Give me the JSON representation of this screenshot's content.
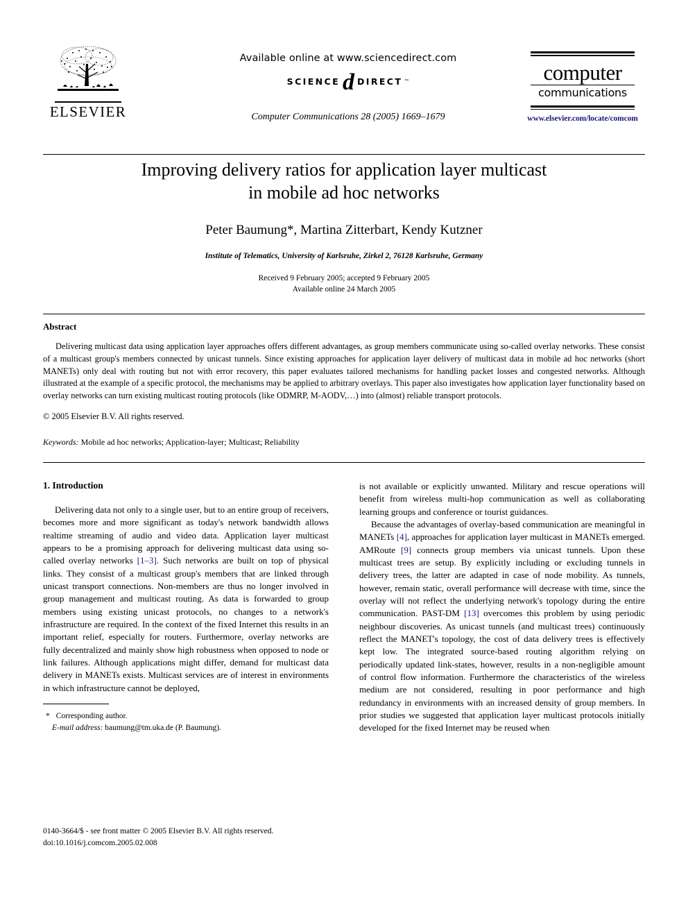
{
  "masthead": {
    "publisher_name": "ELSEVIER",
    "sciencedirect": {
      "available_line": "Available online at www.sciencedirect.com",
      "logo_left": "SCIENCE",
      "logo_at": "d",
      "logo_right": "DIRECT",
      "logo_tm": "™"
    },
    "journal_citation": "Computer Communications 28 (2005) 1669–1679",
    "journal_logo": {
      "line1": "computer",
      "line2": "communications"
    },
    "journal_url": "www.elsevier.com/locate/comcom"
  },
  "title_block": {
    "title_line1": "Improving delivery ratios for application layer multicast",
    "title_line2": "in mobile ad hoc networks",
    "authors": "Peter Baumung*, Martina Zitterbart, Kendy Kutzner",
    "affiliation": "Institute of Telematics, University of Karlsruhe, Zirkel 2, 76128 Karlsruhe, Germany",
    "received_line": "Received 9 February 2005; accepted 9 February 2005",
    "available_line": "Available online 24 March 2005"
  },
  "abstract": {
    "heading": "Abstract",
    "text": "Delivering multicast data using application layer approaches offers different advantages, as group members communicate using so-called overlay networks. These consist of a multicast group's members connected by unicast tunnels. Since existing approaches for application layer delivery of multicast data in mobile ad hoc networks (short MANETs) only deal with routing but not with error recovery, this paper evaluates tailored mechanisms for handling packet losses and congested networks. Although illustrated at the example of a specific protocol, the mechanisms may be applied to arbitrary overlays. This paper also investigates how application layer functionality based on overlay networks can turn existing multicast routing protocols (like ODMRP, M-AODV,…) into (almost) reliable transport protocols.",
    "copyright": "© 2005 Elsevier B.V. All rights reserved.",
    "keywords_label": "Keywords:",
    "keywords_value": "Mobile ad hoc networks; Application-layer; Multicast; Reliability"
  },
  "body": {
    "section_heading": "1. Introduction",
    "left_para1_a": "Delivering data not only to a single user, but to an entire group of receivers, becomes more and more significant as today's network bandwidth allows realtime streaming of audio and video data. Application layer multicast appears to be a promising approach for delivering multicast data using so-called overlay networks ",
    "left_ref1": "[1–3]",
    "left_para1_b": ". Such networks are built on top of physical links. They consist of a multicast group's members that are linked through unicast transport connections. Non-members are thus no longer involved in group management and multicast routing. As data is forwarded to group members using existing unicast protocols, no changes to a network's infrastructure are required. In the context of the fixed Internet this results in an important relief, especially for routers. Furthermore, overlay networks are fully decentralized and mainly show high robustness when opposed to node or link failures. Although applications might differ, demand for multicast data delivery in MANETs exists. Multicast services are of interest in environments in which infrastructure cannot be deployed,",
    "right_para1_cont": "is not available or explicitly unwanted. Military and rescue operations will benefit from wireless multi-hop communication as well as collaborating learning groups and conference or tourist guidances.",
    "right_para2_a": "Because the advantages of overlay-based communication are meaningful in MANETs ",
    "right_ref_4": "[4]",
    "right_para2_b": ", approaches for application layer multicast in MANETs emerged. AMRoute ",
    "right_ref_9": "[9]",
    "right_para2_c": " connects group members via unicast tunnels. Upon these multicast trees are setup. By explicitly including or excluding tunnels in delivery trees, the latter are adapted in case of node mobility. As tunnels, however, remain static, overall performance will decrease with time, since the overlay will not reflect the underlying network's topology during the entire communication. PAST-DM ",
    "right_ref_13": "[13]",
    "right_para2_d": " overcomes this problem by using periodic neighbour discoveries. As unicast tunnels (and multicast trees) continuously reflect the MANET's topology, the cost of data delivery trees is effectively kept low. The integrated source-based routing algorithm relying on periodically updated link-states, however, results in a non-negligible amount of control flow information. Furthermore the characteristics of the wireless medium are not considered, resulting in poor performance and high redundancy in environments with an increased density of group members. In prior studies we suggested that application layer multicast protocols initially developed for the fixed Internet may be reused when"
  },
  "footnote": {
    "star": "*",
    "corresponding": "Corresponding author.",
    "email_label": "E-mail address:",
    "email_value": "baumung@tm.uka.de (P. Baumung)."
  },
  "imprint": {
    "line1": "0140-3664/$ - see front matter © 2005 Elsevier B.V. All rights reserved.",
    "line2": "doi:10.1016/j.comcom.2005.02.008"
  },
  "colors": {
    "reference_link": "#1a1a7a",
    "journal_url": "#1a1a7a",
    "text": "#000000",
    "background": "#ffffff"
  }
}
